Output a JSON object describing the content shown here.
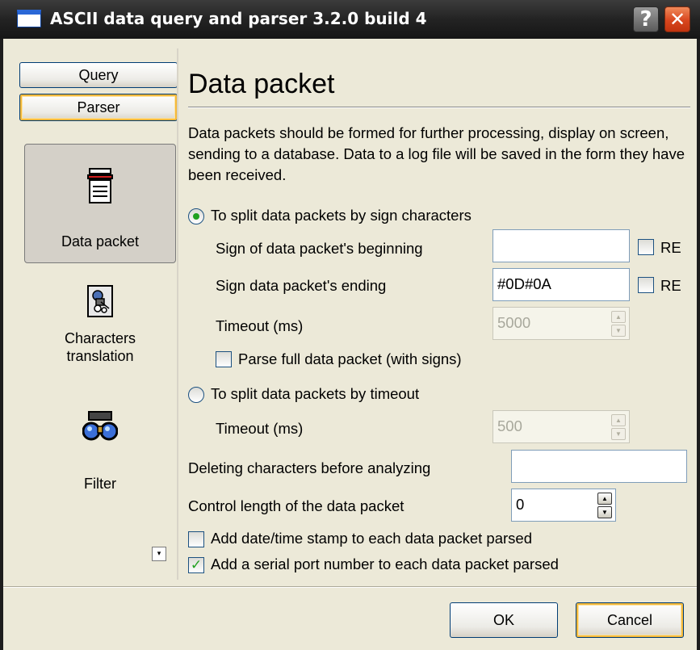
{
  "window": {
    "title": "ASCII data query and parser 3.2.0 build 4",
    "help_label": "?",
    "close_label": "✕"
  },
  "nav": {
    "query_label": "Query",
    "parser_label": "Parser",
    "tiles": [
      {
        "label": "Data packet",
        "icon": "packet-icon",
        "active": true
      },
      {
        "label_line1": "Characters",
        "label_line2": "translation",
        "icon": "translation-icon"
      },
      {
        "label": "Filter",
        "icon": "binoculars-icon"
      }
    ],
    "scroll_label": "▾"
  },
  "panel": {
    "title": "Data packet",
    "description": "Data packets should be formed for further processing, display on screen, sending to a database. Data to a log file will be saved in the form they have been received.",
    "split_by_signs": {
      "label": "To split data packets by sign characters",
      "checked": true,
      "begin_label": "Sign of data packet's beginning",
      "begin_value": "",
      "begin_re_label": "RE",
      "end_label": "Sign data packet's ending",
      "end_value": "#0D#0A",
      "end_re_label": "RE",
      "timeout_label": "Timeout (ms)",
      "timeout_value": "5000",
      "parse_full_label": "Parse full data packet (with signs)"
    },
    "split_by_timeout": {
      "label": "To split data packets by timeout",
      "checked": false,
      "timeout_label": "Timeout (ms)",
      "timeout_value": "500"
    },
    "delete_chars_label": "Deleting characters before analyzing",
    "delete_chars_value": "",
    "control_length_label": "Control length of the data packet",
    "control_length_value": "0",
    "add_timestamp_label": "Add date/time stamp to each data packet parsed",
    "add_timestamp_checked": false,
    "add_port_label": "Add a serial port number to each data packet parsed",
    "add_port_checked": true
  },
  "footer": {
    "ok_label": "OK",
    "cancel_label": "Cancel"
  },
  "colors": {
    "face": "#ece9d8",
    "accent_focus": "#f4b93a",
    "checkmark": "#21a121"
  }
}
